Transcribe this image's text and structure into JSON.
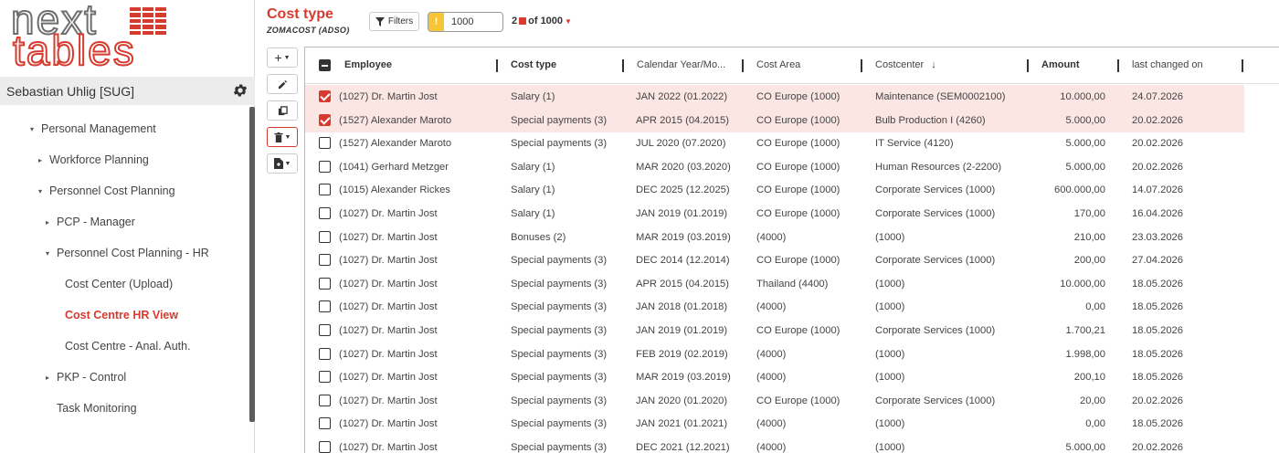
{
  "app": {
    "logo_top": "next",
    "logo_bottom": "tables",
    "user": "Sebastian Uhlig [SUG]"
  },
  "sidebar": {
    "items": [
      {
        "label": "Personal Management",
        "caret": "▾"
      },
      {
        "label": "Workforce Planning",
        "caret": "▸"
      },
      {
        "label": "Personnel Cost Planning",
        "caret": "▾"
      },
      {
        "label": "PCP - Manager",
        "caret": "▸"
      },
      {
        "label": "Personnel Cost Planning - HR",
        "caret": "▾"
      },
      {
        "label": "Cost Center (Upload)",
        "caret": ""
      },
      {
        "label": "Cost Centre HR View",
        "caret": ""
      },
      {
        "label": "Cost Centre - Anal. Auth.",
        "caret": ""
      },
      {
        "label": "PKP - Control",
        "caret": "▸"
      },
      {
        "label": "Task Monitoring",
        "caret": ""
      }
    ],
    "active_item": "Cost Centre HR View"
  },
  "header": {
    "title": "Cost type",
    "subtitle": "ZOMACOST (ADSO)",
    "filters_label": "Filters",
    "limit_value": "1000",
    "selected_count": "2",
    "count_text": "of 1000"
  },
  "table": {
    "columns": [
      "Employee",
      "Cost type",
      "Calendar Year/Mo...",
      "Cost Area",
      "Costcenter",
      "Amount",
      "last changed on"
    ],
    "rows": [
      {
        "selected": true,
        "employee": "(1027) Dr. Martin Jost",
        "cost_type": "Salary (1)",
        "period": "JAN 2022 (01.2022)",
        "cost_area": "CO Europe (1000)",
        "costcenter": "Maintenance (SEM0002100)",
        "amount": "10.000,00",
        "changed": "24.07.2026"
      },
      {
        "selected": true,
        "employee": "(1527) Alexander Maroto",
        "cost_type": "Special payments (3)",
        "period": "APR 2015 (04.2015)",
        "cost_area": "CO Europe (1000)",
        "costcenter": "Bulb Production I (4260)",
        "amount": "5.000,00",
        "changed": "20.02.2026"
      },
      {
        "selected": false,
        "employee": "(1527) Alexander Maroto",
        "cost_type": "Special payments (3)",
        "period": "JUL 2020 (07.2020)",
        "cost_area": "CO Europe (1000)",
        "costcenter": "IT Service (4120)",
        "amount": "5.000,00",
        "changed": "20.02.2026"
      },
      {
        "selected": false,
        "employee": "(1041) Gerhard Metzger",
        "cost_type": "Salary (1)",
        "period": "MAR 2020 (03.2020)",
        "cost_area": "CO Europe (1000)",
        "costcenter": "Human Resources (2-2200)",
        "amount": "5.000,00",
        "changed": "20.02.2026"
      },
      {
        "selected": false,
        "employee": "(1015) Alexander Rickes",
        "cost_type": "Salary (1)",
        "period": "DEC 2025 (12.2025)",
        "cost_area": "CO Europe (1000)",
        "costcenter": "Corporate Services (1000)",
        "amount": "600.000,00",
        "changed": "14.07.2026"
      },
      {
        "selected": false,
        "employee": "(1027) Dr. Martin Jost",
        "cost_type": "Salary (1)",
        "period": "JAN 2019 (01.2019)",
        "cost_area": "CO Europe (1000)",
        "costcenter": "Corporate Services (1000)",
        "amount": "170,00",
        "changed": "16.04.2026"
      },
      {
        "selected": false,
        "employee": "(1027) Dr. Martin Jost",
        "cost_type": "Bonuses (2)",
        "period": "MAR 2019 (03.2019)",
        "cost_area": "(4000)",
        "costcenter": "(1000)",
        "amount": "210,00",
        "changed": "23.03.2026"
      },
      {
        "selected": false,
        "employee": "(1027) Dr. Martin Jost",
        "cost_type": "Special payments (3)",
        "period": "DEC 2014 (12.2014)",
        "cost_area": "CO Europe (1000)",
        "costcenter": "Corporate Services (1000)",
        "amount": "200,00",
        "changed": "27.04.2026"
      },
      {
        "selected": false,
        "employee": "(1027) Dr. Martin Jost",
        "cost_type": "Special payments (3)",
        "period": "APR 2015 (04.2015)",
        "cost_area": "Thailand (4400)",
        "costcenter": "(1000)",
        "amount": "10.000,00",
        "changed": "18.05.2026"
      },
      {
        "selected": false,
        "employee": "(1027) Dr. Martin Jost",
        "cost_type": "Special payments (3)",
        "period": "JAN 2018 (01.2018)",
        "cost_area": "(4000)",
        "costcenter": "(1000)",
        "amount": "0,00",
        "changed": "18.05.2026"
      },
      {
        "selected": false,
        "employee": "(1027) Dr. Martin Jost",
        "cost_type": "Special payments (3)",
        "period": "JAN 2019 (01.2019)",
        "cost_area": "CO Europe (1000)",
        "costcenter": "Corporate Services (1000)",
        "amount": "1.700,21",
        "changed": "18.05.2026"
      },
      {
        "selected": false,
        "employee": "(1027) Dr. Martin Jost",
        "cost_type": "Special payments (3)",
        "period": "FEB 2019 (02.2019)",
        "cost_area": "(4000)",
        "costcenter": "(1000)",
        "amount": "1.998,00",
        "changed": "18.05.2026"
      },
      {
        "selected": false,
        "employee": "(1027) Dr. Martin Jost",
        "cost_type": "Special payments (3)",
        "period": "MAR 2019 (03.2019)",
        "cost_area": "(4000)",
        "costcenter": "(1000)",
        "amount": "200,10",
        "changed": "18.05.2026"
      },
      {
        "selected": false,
        "employee": "(1027) Dr. Martin Jost",
        "cost_type": "Special payments (3)",
        "period": "JAN 2020 (01.2020)",
        "cost_area": "CO Europe (1000)",
        "costcenter": "Corporate Services (1000)",
        "amount": "20,00",
        "changed": "20.02.2026"
      },
      {
        "selected": false,
        "employee": "(1027) Dr. Martin Jost",
        "cost_type": "Special payments (3)",
        "period": "JAN 2021 (01.2021)",
        "cost_area": "(4000)",
        "costcenter": "(1000)",
        "amount": "0,00",
        "changed": "18.05.2026"
      },
      {
        "selected": false,
        "employee": "(1027) Dr. Martin Jost",
        "cost_type": "Special payments (3)",
        "period": "DEC 2021 (12.2021)",
        "cost_area": "(4000)",
        "costcenter": "(1000)",
        "amount": "5.000,00",
        "changed": "20.02.2026"
      }
    ]
  },
  "colors": {
    "accent": "#d73b2f",
    "selected_row": "#fbe6e4",
    "warning": "#f6c53a",
    "sidebar_user_bg": "#ececec"
  },
  "icons": {
    "tools": [
      "plus-icon",
      "pencil-icon",
      "copy-icon",
      "trash-icon",
      "export-icon"
    ],
    "header": [
      "filter-icon",
      "warning-icon"
    ],
    "user": "gear-icon"
  }
}
